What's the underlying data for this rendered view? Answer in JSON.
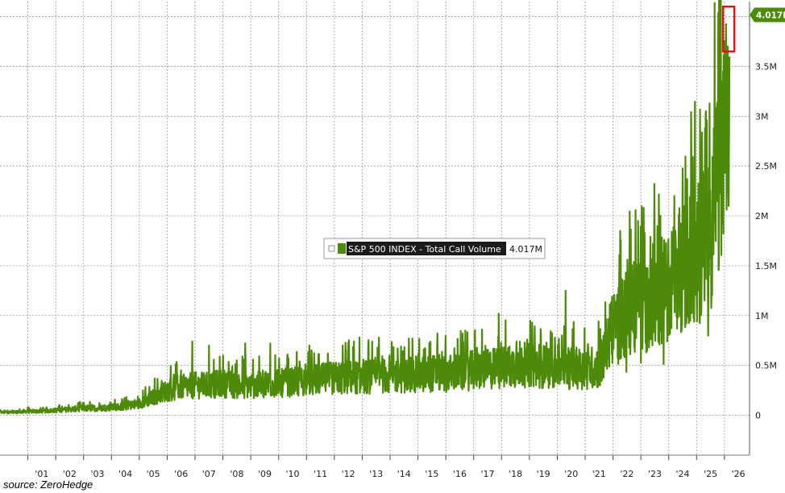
{
  "chart_data": {
    "type": "line",
    "series": [
      {
        "name": "S&P 500 INDEX - Total Call Volume",
        "color": "#4e8a0a",
        "last_value_label": "4.017M",
        "x": [
          2000.5,
          2001,
          2001.5,
          2002,
          2002.5,
          2003,
          2003.5,
          2004,
          2004.5,
          2005,
          2005.5,
          2006,
          2006.5,
          2007,
          2007.5,
          2008,
          2008.5,
          2009,
          2009.5,
          2010,
          2010.5,
          2011,
          2011.5,
          2012,
          2012.5,
          2013,
          2013.5,
          2014,
          2014.5,
          2015,
          2015.5,
          2016,
          2016.5,
          2017,
          2017.5,
          2018,
          2018.5,
          2019,
          2019.5,
          2020,
          2020.5,
          2021,
          2021.5,
          2022,
          2022.5,
          2023,
          2023.5,
          2024,
          2024.5,
          2025,
          2025.5,
          2025.9,
          2026.2
        ],
        "y": [
          0.03,
          0.04,
          0.04,
          0.05,
          0.06,
          0.07,
          0.07,
          0.08,
          0.09,
          0.12,
          0.18,
          0.25,
          0.28,
          0.3,
          0.3,
          0.32,
          0.3,
          0.3,
          0.31,
          0.32,
          0.33,
          0.35,
          0.36,
          0.37,
          0.38,
          0.38,
          0.39,
          0.4,
          0.4,
          0.41,
          0.42,
          0.42,
          0.43,
          0.45,
          0.46,
          0.48,
          0.5,
          0.5,
          0.49,
          0.48,
          0.47,
          0.47,
          0.49,
          0.85,
          1.05,
          1.1,
          1.2,
          1.3,
          1.45,
          1.6,
          1.9,
          2.5,
          3.0
        ],
        "peaks_x": [
          2006.9,
          2007.5,
          2008.8,
          2009.7,
          2011.1,
          2012.3,
          2012.9,
          2013.6,
          2014.8,
          2015.7,
          2016.7,
          2017.9,
          2019.1,
          2020.3,
          2021.7,
          2022.4,
          2022.9,
          2023.1,
          2023.7,
          2024.2,
          2024.9,
          2025.3,
          2025.7,
          2025.95,
          2026.05
        ],
        "peaks_y": [
          0.74,
          0.7,
          0.72,
          0.72,
          0.7,
          0.7,
          0.78,
          0.78,
          0.77,
          0.82,
          0.85,
          1.02,
          0.93,
          1.25,
          0.83,
          1.35,
          1.95,
          2.08,
          2.0,
          2.2,
          2.2,
          2.88,
          3.0,
          3.45,
          3.65
        ]
      }
    ],
    "x_ticks": [
      "'01",
      "'02",
      "'03",
      "'04",
      "'05",
      "'06",
      "'07",
      "'08",
      "'09",
      "'10",
      "'11",
      "'12",
      "'13",
      "'14",
      "'15",
      "'16",
      "'17",
      "'18",
      "'19",
      "'20",
      "'21",
      "'22",
      "'23",
      "'24",
      "'25",
      "'26"
    ],
    "y_ticks": [
      "0",
      "0.5M",
      "1M",
      "1.5M",
      "2M",
      "2.5M",
      "3M",
      "3.5M"
    ],
    "y_tick_values": [
      0,
      0.5,
      1.0,
      1.5,
      2.0,
      2.5,
      3.0,
      3.5
    ],
    "xlim": [
      2000,
      2026.9
    ],
    "ylim": [
      -0.4,
      4.15
    ],
    "grid": true,
    "legend_placement": "center",
    "highlight_box": "latest value",
    "highlight_color": "#e0161b"
  },
  "source_text": "source: ZeroHedge"
}
